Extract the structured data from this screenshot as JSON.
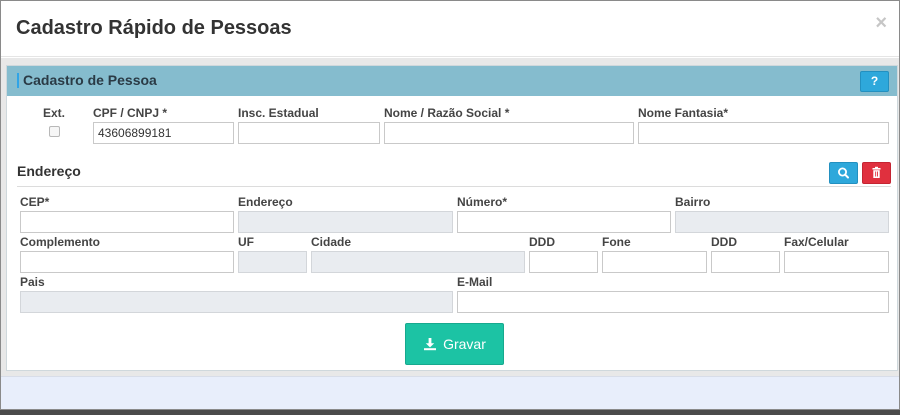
{
  "modal": {
    "title": "Cadastro Rápido de Pessoas",
    "close_label": "×"
  },
  "panel": {
    "title": "Cadastro de Pessoa",
    "help_label": "?"
  },
  "person": {
    "ext_label": "Ext.",
    "cpf_label": "CPF / CNPJ *",
    "cpf_value": "43606899181",
    "inscricao_label": "Insc. Estadual",
    "nome_label": "Nome / Razão Social *",
    "fantasia_label": "Nome Fantasia*"
  },
  "address": {
    "section_title": "Endereço",
    "cep_label": "CEP*",
    "endereco_label": "Endereço",
    "numero_label": "Número*",
    "bairro_label": "Bairro",
    "complemento_label": "Complemento",
    "uf_label": "UF",
    "cidade_label": "Cidade",
    "ddd_label": "DDD",
    "fone_label": "Fone",
    "ddd2_label": "DDD",
    "fax_label": "Fax/Celular",
    "pais_label": "Pais",
    "email_label": "E-Mail"
  },
  "actions": {
    "save_label": "Gravar"
  },
  "colors": {
    "panel_heading": "#85bcce",
    "primary_button": "#2ea8db",
    "danger_button": "#e0303e",
    "save_button": "#1cc3a4"
  },
  "icons": {
    "search": "search-icon",
    "trash": "trash-icon",
    "download": "download-icon",
    "help": "question-icon"
  }
}
